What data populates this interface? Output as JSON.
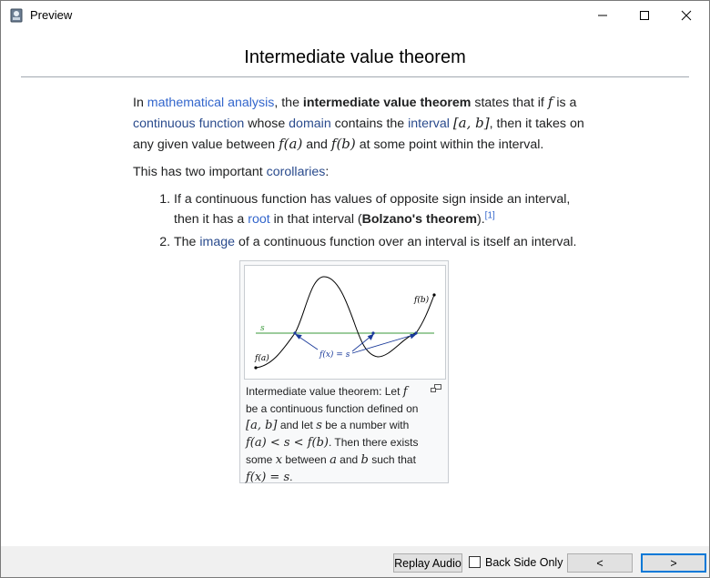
{
  "window": {
    "title": "Preview"
  },
  "article": {
    "heading": "Intermediate value theorem",
    "p1": {
      "t1": "In ",
      "link_math_analysis": "mathematical analysis",
      "t2": ", the ",
      "bold_ivt": "intermediate value theorem",
      "t3": " states that if ",
      "f": "f",
      "t4": " is a ",
      "link_continuous_function": "continuous function",
      "t5": " whose ",
      "link_domain": "domain",
      "t6": " contains the ",
      "link_interval": "interval",
      "sp": " ",
      "interval_ab": "[a, b]",
      "t7": ", then it takes on any given value between ",
      "fa": "f(a)",
      "t8": " and ",
      "fb": "f(b)",
      "t9": " at some point within the interval."
    },
    "p2": {
      "t1": "This has two important ",
      "link_corollaries": "corollaries",
      "t2": ":"
    },
    "list": {
      "item1": {
        "t1": "If a continuous function has values of opposite sign inside an interval, then it has a ",
        "link_root": "root",
        "t2": " in that interval (",
        "bold": "Bolzano's theorem",
        "t3": ").",
        "ref": "[1]"
      },
      "item2": {
        "t1": "The ",
        "link_image": "image",
        "t2": " of a continuous function over an interval is itself an interval."
      }
    },
    "figure": {
      "labels": {
        "s": "s",
        "fa": "f(a)",
        "fb": "f(b)",
        "fx_eq_s": "f(x) = s"
      },
      "caption": {
        "t1": "Intermediate value theorem: Let ",
        "f": "f",
        "t2": " be a continuous function defined on ",
        "ab": "[a, b]",
        "t3": " and let ",
        "s": "s",
        "t4": " be a number with ",
        "ineq": "f(a) < s < f(b)",
        "t5": ". Then there exists some ",
        "x": "x",
        "t6": " between ",
        "a": "a",
        "t7": " and ",
        "b": "b",
        "t8": " such that ",
        "eq": "f(x) = s",
        "t9": "."
      }
    }
  },
  "bottom": {
    "replay_audio": "Replay Audio",
    "back_side_only": "Back Side Only",
    "prev": "<",
    "next": ">"
  },
  "colors": {
    "link": "#3366cc",
    "visited_link": "#2a4b8d",
    "accent_button_border": "#0078d7",
    "s_line": "#3a9a3a",
    "arrow": "#1a3a9a"
  }
}
